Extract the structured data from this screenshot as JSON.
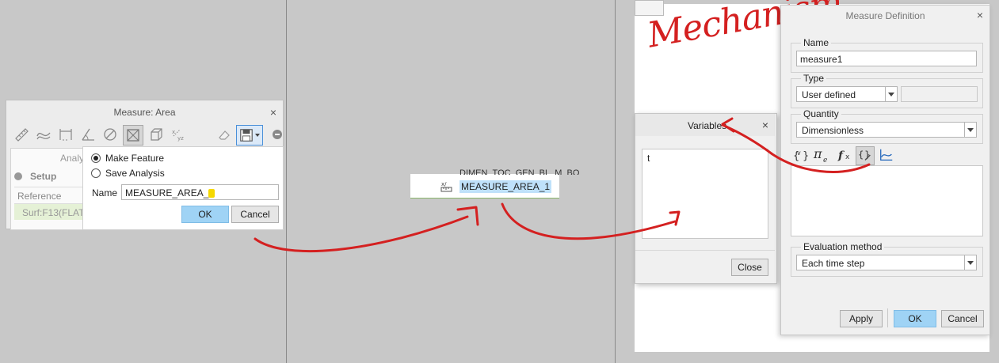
{
  "measure_area": {
    "title": "Measure: Area",
    "close": "×",
    "panel_heading": "Analy",
    "setup_label": "Setup",
    "reference_label": "Reference",
    "reference_value": "Surf:F13(FLAT",
    "make_feature_label": "Make Feature",
    "save_analysis_label": "Save Analysis",
    "selected_option": "Make Feature",
    "name_label": "Name",
    "name_value": "MEASURE_AREA_",
    "ok_label": "OK",
    "cancel_label": "Cancel",
    "toolbar_icons": [
      "ruler-icon",
      "curve-icon",
      "dimension-icon",
      "angle-icon",
      "diameter-icon",
      "area-icon",
      "volume-icon",
      "transform-icon",
      "eraser-icon",
      "save-icon"
    ]
  },
  "model_tree": {
    "partial_row": "DIMEN_TOC_GEN_BL_M_BO",
    "feature_label": "MEASURE_AREA_1",
    "feature_icon": "analysis-feature-icon"
  },
  "canvas": {
    "handwriting": "Mechanism"
  },
  "variables_dialog": {
    "title": "Variables",
    "close": "×",
    "items": [
      "t"
    ],
    "close_button": "Close"
  },
  "measure_definition": {
    "title": "Measure Definition",
    "close": "×",
    "name_group": "Name",
    "name_value": "measure1",
    "type_group": "Type",
    "type_value": "User defined",
    "quantity_group": "Quantity",
    "quantity_value": "Dimensionless",
    "quantity_icons": [
      "variables-icon",
      "constants-icon",
      "function-icon",
      "measure-select-icon",
      "graph-icon"
    ],
    "evaluation_group": "Evaluation method",
    "evaluation_value": "Each time step",
    "apply_label": "Apply",
    "ok_label": "OK",
    "cancel_label": "Cancel"
  },
  "colors": {
    "annotation": "#d42020",
    "primary_button": "#9fd3f5",
    "selection": "#bfe1fa",
    "background": "#c8c8c8"
  }
}
